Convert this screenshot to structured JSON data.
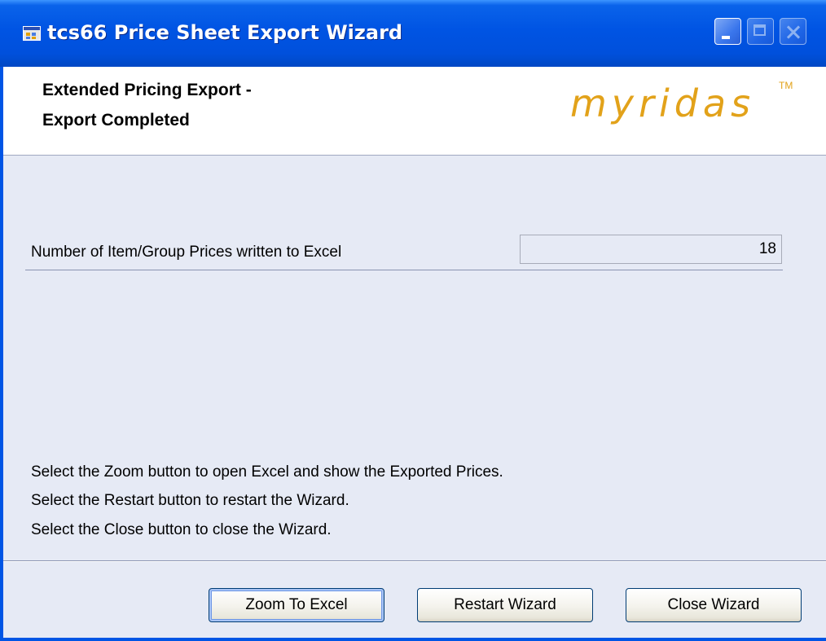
{
  "window": {
    "title": "tcs66 Price Sheet Export Wizard",
    "icon": "app-window-icon",
    "controls": [
      "minimize",
      "maximize",
      "close"
    ]
  },
  "header": {
    "line1": "Extended Pricing Export -",
    "line2": "Export Completed",
    "logo_text": "myridas",
    "logo_tm": "TM",
    "logo_color": "#e2a21a"
  },
  "body": {
    "count_label": "Number of Item/Group Prices written to Excel",
    "count_value": "18",
    "instructions": [
      "Select the Zoom button to open Excel and show the Exported Prices.",
      "Select the Restart button to restart the Wizard.",
      "Select the Close button to close the Wizard."
    ]
  },
  "buttons": {
    "zoom_label": "Zoom To Excel",
    "restart_label": "Restart Wizard",
    "close_label": "Close Wizard"
  },
  "colors": {
    "titlebar": "#0054e3",
    "body_bg": "#e6eaf5",
    "header_bg": "#ffffff"
  }
}
